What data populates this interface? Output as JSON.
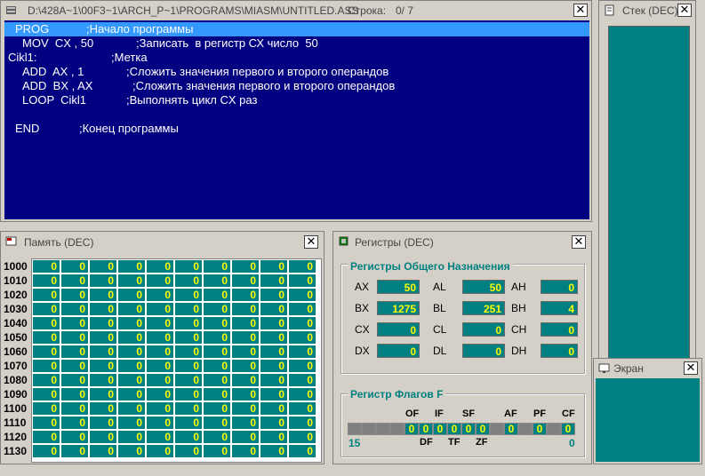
{
  "editor": {
    "title": "D:\\428A~1\\00F3~1\\ARCH_P~1\\PROGRAMS\\MIASM\\UNTITLED.ASS",
    "line_label": "Строка:",
    "line_value": "0/ 7",
    "lines": [
      {
        "label": "PROG",
        "instr": "",
        "comment": ";Начало программы",
        "selected": true
      },
      {
        "label": "",
        "instr": "MOV  CX , 50",
        "comment": ";Записать  в регистр СХ число  50"
      },
      {
        "label": "Cikl1:",
        "instr": "",
        "comment": ";Метка"
      },
      {
        "label": "",
        "instr": "ADD  AX , 1",
        "comment": ";Сложить значения первого и второго операндов"
      },
      {
        "label": "",
        "instr": "ADD  BX , AX",
        "comment": ";Сложить значения первого и второго операндов"
      },
      {
        "label": "",
        "instr": "LOOP  Cikl1",
        "comment": ";Выполнять цикл CX раз"
      },
      {
        "label": "",
        "instr": "",
        "comment": ""
      },
      {
        "label": "END",
        "instr": "",
        "comment": ";Конец программы"
      }
    ]
  },
  "stack": {
    "title": "Стек (DEC)"
  },
  "screen": {
    "title": "Экран"
  },
  "memory": {
    "title": "Память (DEC)",
    "rows": [
      {
        "addr": "1000",
        "values": [
          "0",
          "0",
          "0",
          "0",
          "0",
          "0",
          "0",
          "0",
          "0",
          "0"
        ]
      },
      {
        "addr": "1010",
        "values": [
          "0",
          "0",
          "0",
          "0",
          "0",
          "0",
          "0",
          "0",
          "0",
          "0"
        ]
      },
      {
        "addr": "1020",
        "values": [
          "0",
          "0",
          "0",
          "0",
          "0",
          "0",
          "0",
          "0",
          "0",
          "0"
        ]
      },
      {
        "addr": "1030",
        "values": [
          "0",
          "0",
          "0",
          "0",
          "0",
          "0",
          "0",
          "0",
          "0",
          "0"
        ]
      },
      {
        "addr": "1040",
        "values": [
          "0",
          "0",
          "0",
          "0",
          "0",
          "0",
          "0",
          "0",
          "0",
          "0"
        ]
      },
      {
        "addr": "1050",
        "values": [
          "0",
          "0",
          "0",
          "0",
          "0",
          "0",
          "0",
          "0",
          "0",
          "0"
        ]
      },
      {
        "addr": "1060",
        "values": [
          "0",
          "0",
          "0",
          "0",
          "0",
          "0",
          "0",
          "0",
          "0",
          "0"
        ]
      },
      {
        "addr": "1070",
        "values": [
          "0",
          "0",
          "0",
          "0",
          "0",
          "0",
          "0",
          "0",
          "0",
          "0"
        ]
      },
      {
        "addr": "1080",
        "values": [
          "0",
          "0",
          "0",
          "0",
          "0",
          "0",
          "0",
          "0",
          "0",
          "0"
        ]
      },
      {
        "addr": "1090",
        "values": [
          "0",
          "0",
          "0",
          "0",
          "0",
          "0",
          "0",
          "0",
          "0",
          "0"
        ]
      },
      {
        "addr": "1100",
        "values": [
          "0",
          "0",
          "0",
          "0",
          "0",
          "0",
          "0",
          "0",
          "0",
          "0"
        ]
      },
      {
        "addr": "1110",
        "values": [
          "0",
          "0",
          "0",
          "0",
          "0",
          "0",
          "0",
          "0",
          "0",
          "0"
        ]
      },
      {
        "addr": "1120",
        "values": [
          "0",
          "0",
          "0",
          "0",
          "0",
          "0",
          "0",
          "0",
          "0",
          "0"
        ]
      },
      {
        "addr": "1130",
        "values": [
          "0",
          "0",
          "0",
          "0",
          "0",
          "0",
          "0",
          "0",
          "0",
          "0"
        ]
      }
    ]
  },
  "registers": {
    "title": "Регистры (DEC)",
    "gp_title": "Регистры Общего Назначения",
    "rows": [
      [
        {
          "name": "AX",
          "value": "50"
        },
        {
          "name": "AL",
          "value": "50"
        },
        {
          "name": "AH",
          "value": "0"
        }
      ],
      [
        {
          "name": "BX",
          "value": "1275"
        },
        {
          "name": "BL",
          "value": "251"
        },
        {
          "name": "BH",
          "value": "4"
        }
      ],
      [
        {
          "name": "CX",
          "value": "0"
        },
        {
          "name": "CL",
          "value": "0"
        },
        {
          "name": "CH",
          "value": "0"
        }
      ],
      [
        {
          "name": "DX",
          "value": "0"
        },
        {
          "name": "DL",
          "value": "0"
        },
        {
          "name": "DH",
          "value": "0"
        }
      ]
    ],
    "flags_title": "Регистр Флагов  F",
    "flag_top_labels": [
      "OF",
      "IF",
      "SF",
      "AF",
      "PF",
      "CF"
    ],
    "flag_bottom_labels": [
      "DF",
      "TF",
      "ZF"
    ],
    "flag_bits": [
      "",
      "",
      "",
      "",
      "0",
      "0",
      "0",
      "0",
      "0",
      "0",
      "",
      "0",
      "",
      "0",
      "",
      "0"
    ],
    "bit_high": "15",
    "bit_low": "0"
  },
  "colors": {
    "editor_bg": "#000080",
    "editor_selection": "#3399ff",
    "cell_bg": "#008080",
    "cell_text": "#ffff00",
    "group_title": "#008080"
  }
}
